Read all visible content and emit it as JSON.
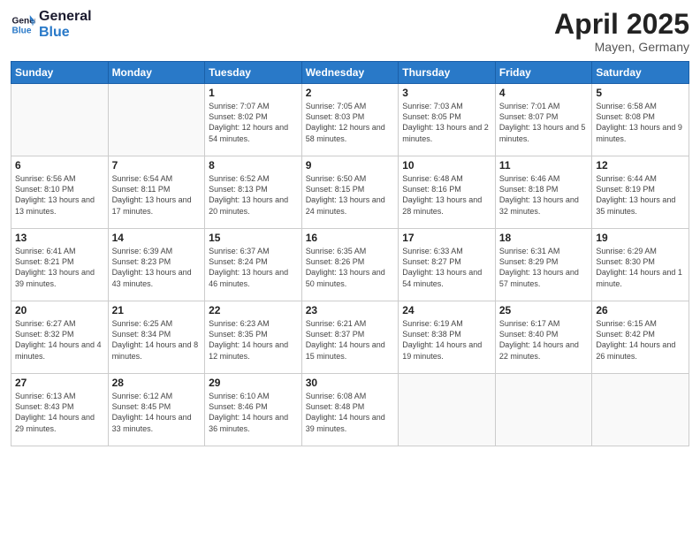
{
  "header": {
    "logo_line1": "General",
    "logo_line2": "Blue",
    "month_title": "April 2025",
    "subtitle": "Mayen, Germany"
  },
  "weekdays": [
    "Sunday",
    "Monday",
    "Tuesday",
    "Wednesday",
    "Thursday",
    "Friday",
    "Saturday"
  ],
  "weeks": [
    [
      {
        "day": "",
        "info": ""
      },
      {
        "day": "",
        "info": ""
      },
      {
        "day": "1",
        "info": "Sunrise: 7:07 AM\nSunset: 8:02 PM\nDaylight: 12 hours\nand 54 minutes."
      },
      {
        "day": "2",
        "info": "Sunrise: 7:05 AM\nSunset: 8:03 PM\nDaylight: 12 hours\nand 58 minutes."
      },
      {
        "day": "3",
        "info": "Sunrise: 7:03 AM\nSunset: 8:05 PM\nDaylight: 13 hours\nand 2 minutes."
      },
      {
        "day": "4",
        "info": "Sunrise: 7:01 AM\nSunset: 8:07 PM\nDaylight: 13 hours\nand 5 minutes."
      },
      {
        "day": "5",
        "info": "Sunrise: 6:58 AM\nSunset: 8:08 PM\nDaylight: 13 hours\nand 9 minutes."
      }
    ],
    [
      {
        "day": "6",
        "info": "Sunrise: 6:56 AM\nSunset: 8:10 PM\nDaylight: 13 hours\nand 13 minutes."
      },
      {
        "day": "7",
        "info": "Sunrise: 6:54 AM\nSunset: 8:11 PM\nDaylight: 13 hours\nand 17 minutes."
      },
      {
        "day": "8",
        "info": "Sunrise: 6:52 AM\nSunset: 8:13 PM\nDaylight: 13 hours\nand 20 minutes."
      },
      {
        "day": "9",
        "info": "Sunrise: 6:50 AM\nSunset: 8:15 PM\nDaylight: 13 hours\nand 24 minutes."
      },
      {
        "day": "10",
        "info": "Sunrise: 6:48 AM\nSunset: 8:16 PM\nDaylight: 13 hours\nand 28 minutes."
      },
      {
        "day": "11",
        "info": "Sunrise: 6:46 AM\nSunset: 8:18 PM\nDaylight: 13 hours\nand 32 minutes."
      },
      {
        "day": "12",
        "info": "Sunrise: 6:44 AM\nSunset: 8:19 PM\nDaylight: 13 hours\nand 35 minutes."
      }
    ],
    [
      {
        "day": "13",
        "info": "Sunrise: 6:41 AM\nSunset: 8:21 PM\nDaylight: 13 hours\nand 39 minutes."
      },
      {
        "day": "14",
        "info": "Sunrise: 6:39 AM\nSunset: 8:23 PM\nDaylight: 13 hours\nand 43 minutes."
      },
      {
        "day": "15",
        "info": "Sunrise: 6:37 AM\nSunset: 8:24 PM\nDaylight: 13 hours\nand 46 minutes."
      },
      {
        "day": "16",
        "info": "Sunrise: 6:35 AM\nSunset: 8:26 PM\nDaylight: 13 hours\nand 50 minutes."
      },
      {
        "day": "17",
        "info": "Sunrise: 6:33 AM\nSunset: 8:27 PM\nDaylight: 13 hours\nand 54 minutes."
      },
      {
        "day": "18",
        "info": "Sunrise: 6:31 AM\nSunset: 8:29 PM\nDaylight: 13 hours\nand 57 minutes."
      },
      {
        "day": "19",
        "info": "Sunrise: 6:29 AM\nSunset: 8:30 PM\nDaylight: 14 hours\nand 1 minute."
      }
    ],
    [
      {
        "day": "20",
        "info": "Sunrise: 6:27 AM\nSunset: 8:32 PM\nDaylight: 14 hours\nand 4 minutes."
      },
      {
        "day": "21",
        "info": "Sunrise: 6:25 AM\nSunset: 8:34 PM\nDaylight: 14 hours\nand 8 minutes."
      },
      {
        "day": "22",
        "info": "Sunrise: 6:23 AM\nSunset: 8:35 PM\nDaylight: 14 hours\nand 12 minutes."
      },
      {
        "day": "23",
        "info": "Sunrise: 6:21 AM\nSunset: 8:37 PM\nDaylight: 14 hours\nand 15 minutes."
      },
      {
        "day": "24",
        "info": "Sunrise: 6:19 AM\nSunset: 8:38 PM\nDaylight: 14 hours\nand 19 minutes."
      },
      {
        "day": "25",
        "info": "Sunrise: 6:17 AM\nSunset: 8:40 PM\nDaylight: 14 hours\nand 22 minutes."
      },
      {
        "day": "26",
        "info": "Sunrise: 6:15 AM\nSunset: 8:42 PM\nDaylight: 14 hours\nand 26 minutes."
      }
    ],
    [
      {
        "day": "27",
        "info": "Sunrise: 6:13 AM\nSunset: 8:43 PM\nDaylight: 14 hours\nand 29 minutes."
      },
      {
        "day": "28",
        "info": "Sunrise: 6:12 AM\nSunset: 8:45 PM\nDaylight: 14 hours\nand 33 minutes."
      },
      {
        "day": "29",
        "info": "Sunrise: 6:10 AM\nSunset: 8:46 PM\nDaylight: 14 hours\nand 36 minutes."
      },
      {
        "day": "30",
        "info": "Sunrise: 6:08 AM\nSunset: 8:48 PM\nDaylight: 14 hours\nand 39 minutes."
      },
      {
        "day": "",
        "info": ""
      },
      {
        "day": "",
        "info": ""
      },
      {
        "day": "",
        "info": ""
      }
    ]
  ]
}
